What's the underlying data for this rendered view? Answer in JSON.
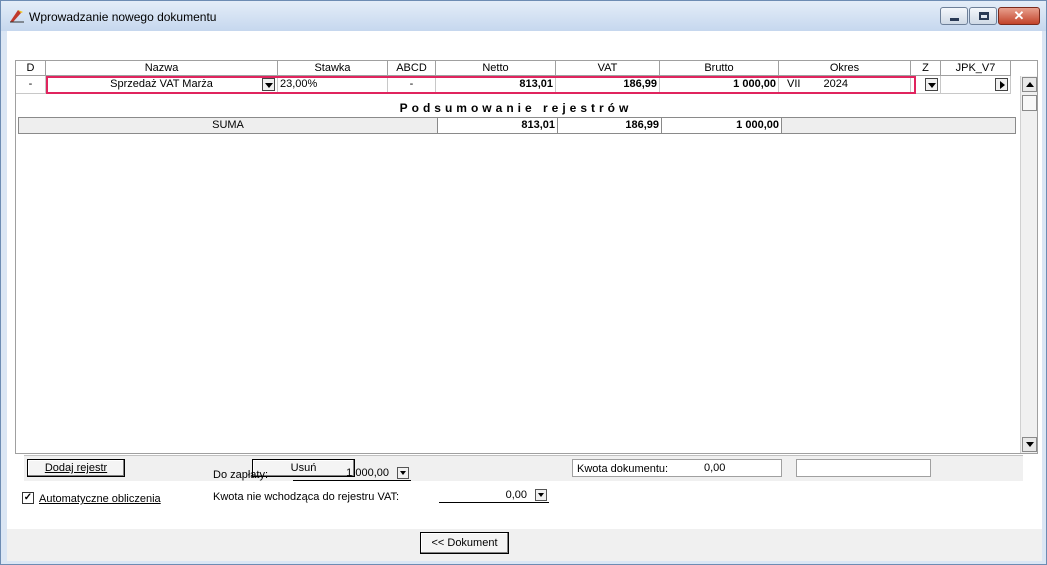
{
  "window": {
    "title": "Wprowadzanie nowego dokumentu",
    "controls": {
      "minimize": "▭",
      "maximize": "▢",
      "close": "✕"
    }
  },
  "grid": {
    "headers": [
      "D",
      "Nazwa",
      "Stawka",
      "ABCD",
      "Netto",
      "VAT",
      "Brutto",
      "Okres",
      "Z",
      "JPK_V7"
    ],
    "row": {
      "d": "-",
      "nazwa": "Sprzedaż VAT Marża",
      "stawka": "23,00%",
      "abcd": "-",
      "netto": "813,01",
      "vat": "186,99",
      "brutto": "1 000,00",
      "okres_month": "VII",
      "okres_year": "2024",
      "z": "",
      "jpk": ""
    },
    "summary": {
      "title": "Podsumowanie rejestrów",
      "label": "SUMA",
      "netto": "813,01",
      "vat": "186,99",
      "brutto": "1 000,00"
    }
  },
  "bottom_bar": {
    "add_button": "Dodaj rejestr",
    "delete_button": "Usuń",
    "kwota_label": "Kwota dokumentu:",
    "kwota_value": "0,00"
  },
  "lower": {
    "do_zaplaty_label": "Do zapłaty:",
    "do_zaplaty_value": "1 000,00",
    "auto_label": "Automatyczne obliczenia",
    "auto_checked": "✓",
    "kwota_nie_label": "Kwota nie wchodząca do rejestru VAT:",
    "kwota_nie_value": "0,00"
  },
  "footer": {
    "dokument_button": "<< Dokument"
  },
  "icons": {
    "app": "document-icon",
    "combo": "chevron-down-icon",
    "nav_right": "chevron-right-icon",
    "scroll_up": "arrow-up-icon",
    "scroll_down": "arrow-down-icon"
  },
  "colors": {
    "selection_outline": "#e0245e",
    "title_bg": "#c6d7ee"
  }
}
